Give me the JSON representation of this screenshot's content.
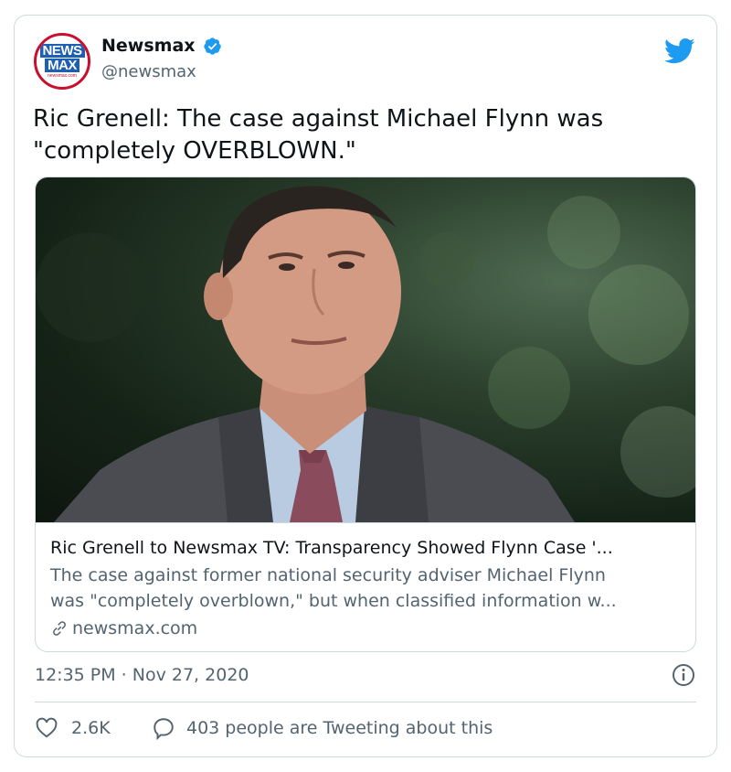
{
  "author": {
    "display_name": "Newsmax",
    "handle": "@newsmax",
    "avatar": {
      "line1": "NEWS",
      "line2": "MAX",
      "url": "newsmax.com"
    },
    "verified": true
  },
  "tweet": {
    "text_line1": "Ric Grenell: The case against Michael Flynn was",
    "text_line2": "\"completely OVERBLOWN.\""
  },
  "link_card": {
    "title": "Ric Grenell to Newsmax TV: Transparency Showed Flynn Case '...",
    "description_line1": "The case against former national security adviser Michael Flynn",
    "description_line2": "was \"completely overblown,\" but when classified information w...",
    "domain": "newsmax.com"
  },
  "meta": {
    "timestamp": "12:35 PM · Nov 27, 2020"
  },
  "actions": {
    "like_count": "2.6K",
    "conversation_text": "403 people are Tweeting about this"
  },
  "colors": {
    "twitter_blue": "#1d9bf0",
    "secondary_text": "#536471",
    "border": "#cfd9de",
    "newsmax_red": "#c8102e",
    "newsmax_blue": "#1d5fb4"
  },
  "icons": [
    "verified-badge-icon",
    "twitter-bird-icon",
    "link-icon",
    "info-icon",
    "heart-icon",
    "reply-bubble-icon"
  ]
}
